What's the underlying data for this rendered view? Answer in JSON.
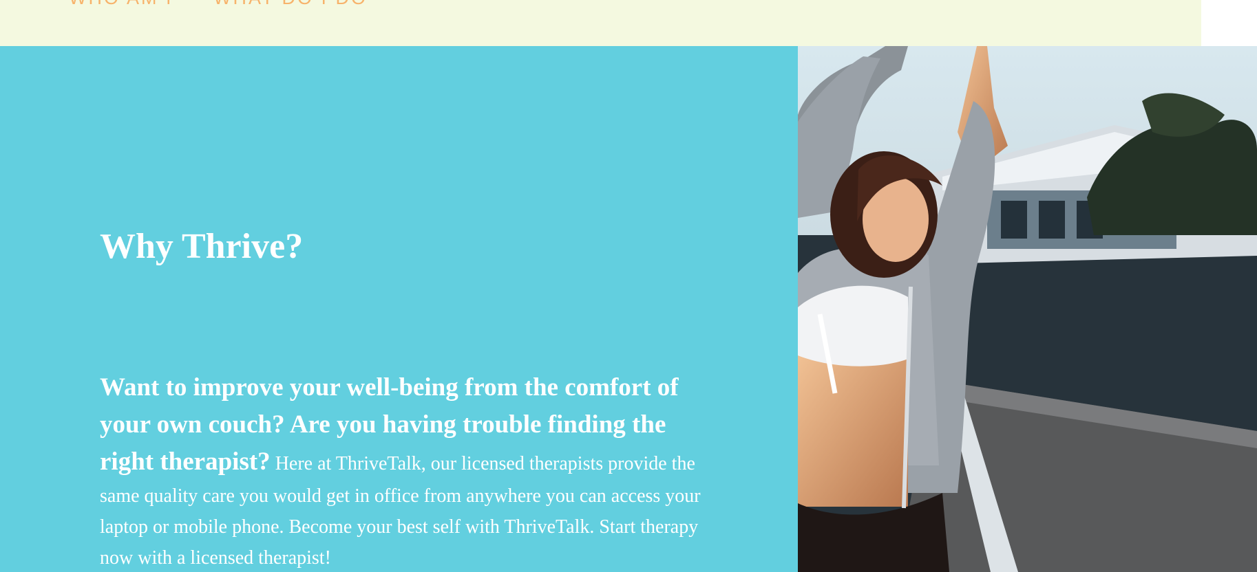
{
  "nav": {
    "items": [
      {
        "label": "WHO AM I"
      },
      {
        "label": "WHAT DO I DO"
      }
    ]
  },
  "hero": {
    "title": "Why Thrive?",
    "lead": "Want to improve your well-being from the comfort of your own couch? Are you having trouble finding the right therapist?",
    "body": "Here at ThriveTalk, our licensed therapists provide the same quality care you would get in office from anywhere you can access your laptop or mobile phone. Become your best self with ThriveTalk. Start therapy now with a licensed therapist!"
  },
  "colors": {
    "topbar_bg": "#f4f9e0",
    "nav_text": "#f7b36b",
    "hero_bg": "#62cfdf",
    "hero_text": "#ffffff"
  },
  "image": {
    "alt": "woman-stretching-on-dock"
  }
}
